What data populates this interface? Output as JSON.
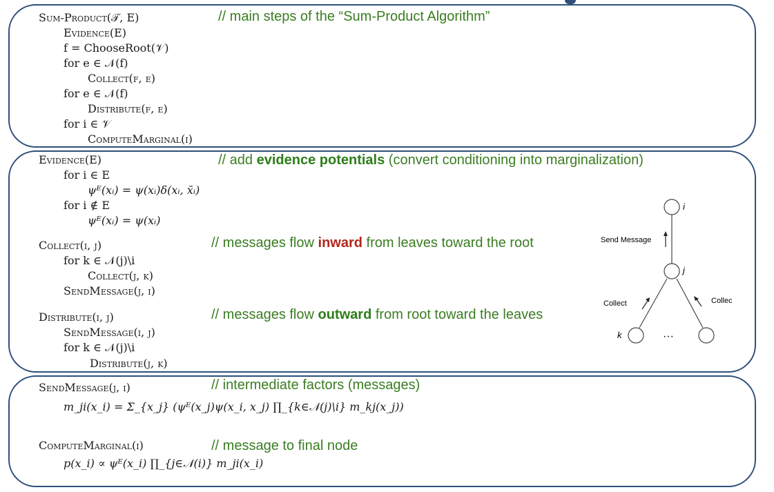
{
  "panel1": {
    "lines": [
      "Sum-Product(𝒯, E)",
      "Evidence(E)",
      "f = ChooseRoot(𝒱)",
      "for e ∈ 𝒩(f)",
      "Collect(f, e)",
      "for e ∈ 𝒩(f)",
      "Distribute(f, e)",
      "for i ∈ 𝒱",
      "ComputeMarginal(i)"
    ],
    "comment": "// main steps of the “Sum-Product Algorithm”"
  },
  "panel2": {
    "evidence_lines": [
      "Evidence(E)",
      "for i ∈ E",
      "ψᴱ(xᵢ) = ψ(xᵢ)δ(xᵢ, x̄ᵢ)",
      "for i ∉ E",
      "ψᴱ(xᵢ) = ψ(xᵢ)"
    ],
    "evidence_comment_prefix": "// add ",
    "evidence_comment_bold": "evidence potentials",
    "evidence_comment_suffix": " (convert conditioning into marginalization)",
    "collect_lines": [
      "Collect(i, j)",
      "for k ∈ 𝒩(j)\\i",
      "Collect(j, k)",
      "SendMessage(j, i)"
    ],
    "collect_comment_prefix": "// messages flow ",
    "collect_comment_bold": "inward",
    "collect_comment_suffix": " from leaves toward the root",
    "distribute_lines": [
      "Distribute(i, j)",
      "SendMessage(i, j)",
      "for k ∈ 𝒩(j)\\i",
      "Distribute(j, k)"
    ],
    "distribute_comment_prefix": "// messages flow ",
    "distribute_comment_bold": "outward",
    "distribute_comment_suffix": " from root toward the leaves"
  },
  "diagram": {
    "node_i": "i",
    "node_j": "j",
    "node_k": "k",
    "dots": "···",
    "send_message": "Send Message",
    "collect_left": "Collect",
    "collect_right": "Collect"
  },
  "panel3": {
    "send_header": "SendMessage(j, i)",
    "send_formula": "m_ji(x_i) = Σ_{x_j} (ψᴱ(x_j)ψ(x_i, x_j) ∏_{k∈𝒩(j)\\i} m_kj(x_j))",
    "send_comment": "// intermediate factors (messages)",
    "marg_header": "ComputeMarginal(i)",
    "marg_formula": "p(x_i) ∝ ψᴱ(x_i) ∏_{j∈𝒩(i)} m_ji(x_i)",
    "marg_comment": "// message to final node"
  },
  "colors": {
    "border": "#2f4f7a",
    "comment_green": "#3a7d22",
    "emphasis_red": "#b3261e"
  }
}
